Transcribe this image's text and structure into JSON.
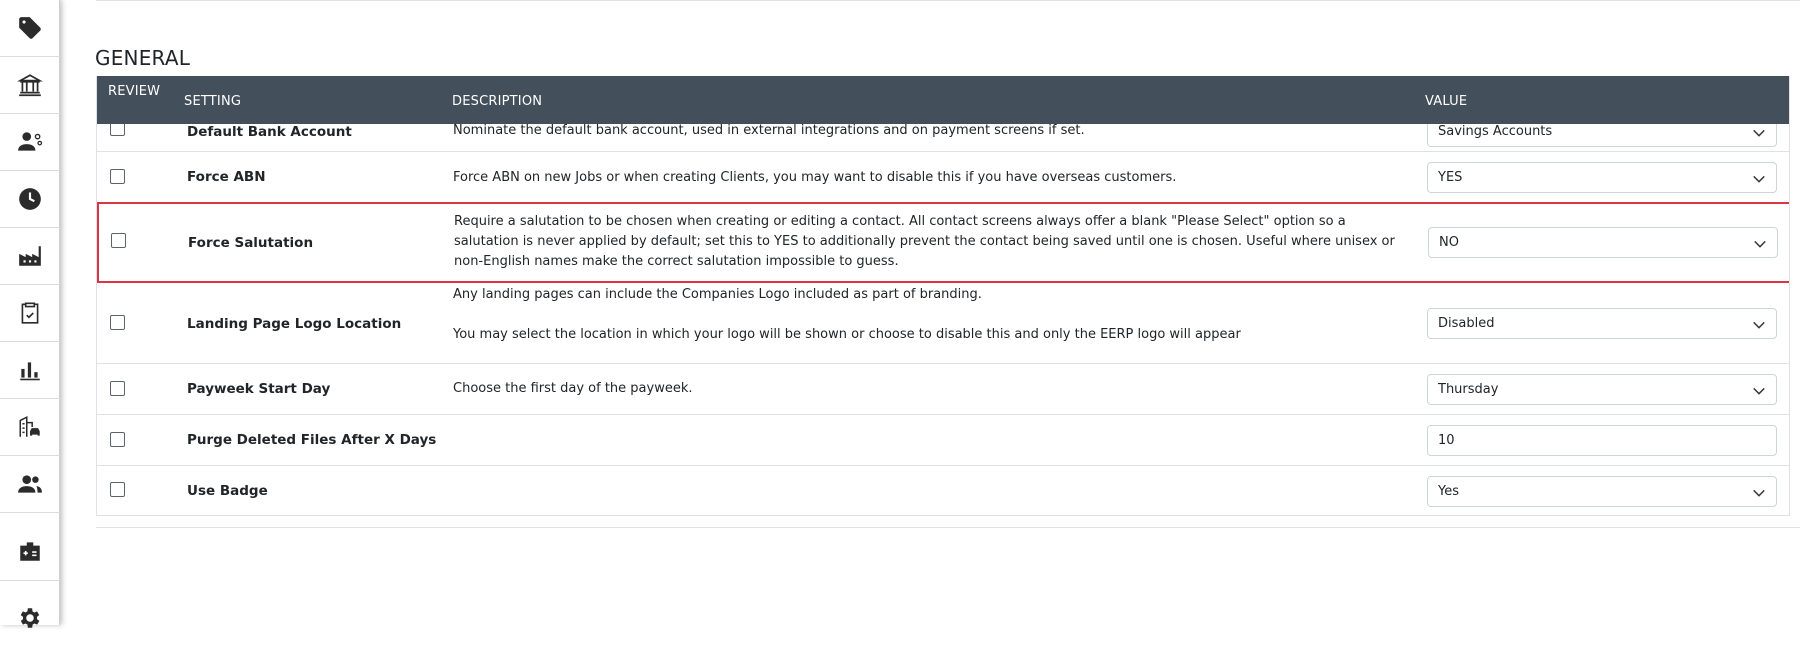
{
  "sidebar": {
    "items": [
      {
        "icon": "tag-icon"
      },
      {
        "icon": "bank-icon"
      },
      {
        "icon": "user-settings-icon"
      },
      {
        "icon": "clock-icon"
      },
      {
        "icon": "factory-icon"
      },
      {
        "icon": "clipboard-check-icon"
      },
      {
        "icon": "bar-chart-icon"
      },
      {
        "icon": "building-car-icon"
      },
      {
        "icon": "people-icon"
      },
      {
        "icon": "id-card-icon"
      },
      {
        "icon": "gear-icon"
      }
    ]
  },
  "section": {
    "title": "GENERAL"
  },
  "table": {
    "headers": {
      "review": "REVIEW",
      "setting": "SETTING",
      "description": "DESCRIPTION",
      "value": "VALUE"
    },
    "rows": [
      {
        "setting": "Default Bank Account",
        "description": [
          "Nominate the default bank account, used in external integrations and on payment screens if set."
        ],
        "value": "Savings Accounts",
        "control": "select"
      },
      {
        "setting": "Force ABN",
        "description": [
          "Force ABN on new Jobs or when creating Clients, you may want to disable this if you have overseas customers."
        ],
        "value": "YES",
        "control": "select"
      },
      {
        "setting": "Force Salutation",
        "description": [
          "Require a salutation to be chosen when creating or editing a contact. All contact screens always offer a blank \"Please Select\" option so a salutation is never applied by default; set this to YES to additionally prevent the contact being saved until one is chosen. Useful where unisex or non-English names make the correct salutation impossible to guess."
        ],
        "value": "NO",
        "control": "select"
      },
      {
        "setting": "Landing Page Logo Location",
        "description": [
          "Any landing pages can include the Companies Logo included as part of branding.",
          "You may select the location in which your logo will be shown or choose to disable this and only the EERP logo will appear"
        ],
        "value": "Disabled",
        "control": "select"
      },
      {
        "setting": "Payweek Start Day",
        "description": [
          "Choose the first day of the payweek."
        ],
        "value": "Thursday",
        "control": "select"
      },
      {
        "setting": "Purge Deleted Files After X Days",
        "description": [],
        "value": "10",
        "control": "input"
      },
      {
        "setting": "Use Badge",
        "description": [],
        "value": "Yes",
        "control": "select"
      }
    ]
  },
  "colors": {
    "header_bg": "#434f5a",
    "highlight_border": "#dc3545"
  }
}
